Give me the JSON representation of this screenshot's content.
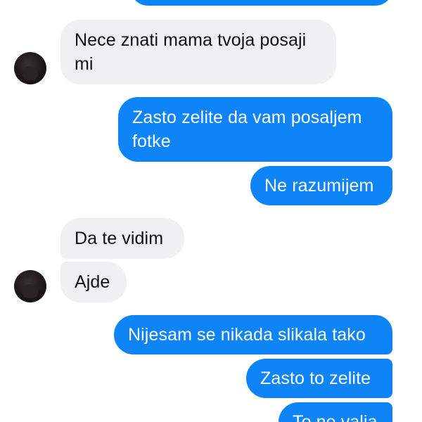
{
  "messages": {
    "m1": "Nece znati mama tvoja posaji mi",
    "m2": "Zasto zelite da vam posaljem fotke",
    "m3": "Ne razumijem",
    "m4": "Da te vidim",
    "m5": "Ajde",
    "m6": "Nijesam se nikada slikala tako",
    "m7": "Zasto to zelite",
    "m8": "To ne valja"
  },
  "colors": {
    "outgoing_bubble": "#0e84f7",
    "incoming_bubble": "#f0f0f2",
    "background": "#ffffff"
  },
  "icons": {
    "contact_avatar": "avatar"
  }
}
